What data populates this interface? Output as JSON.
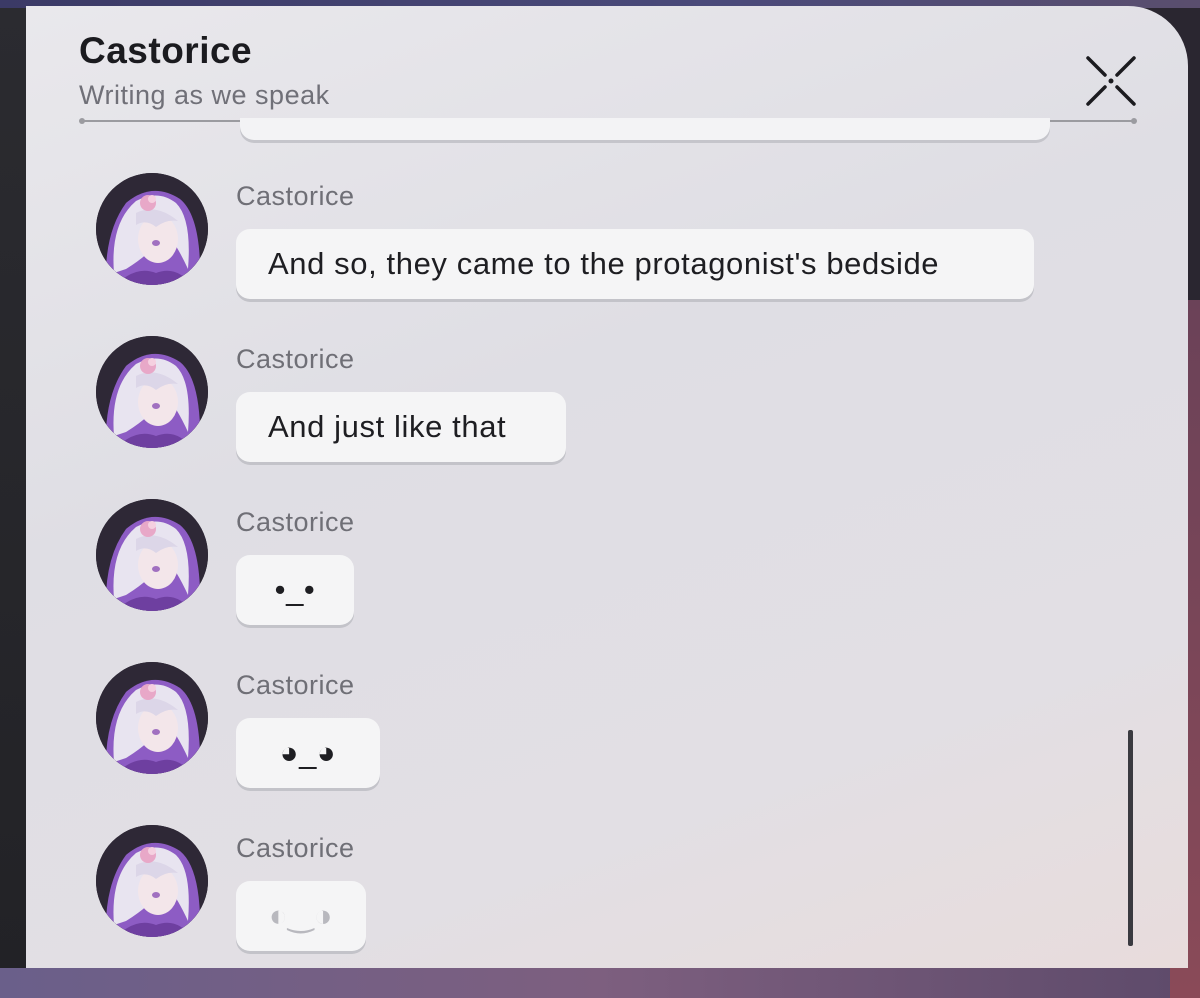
{
  "header": {
    "title": "Castorice",
    "subtitle": "Writing as we speak"
  },
  "messages": [
    {
      "sender": "Castorice",
      "text": "And so, they came to the protagonist's bedside"
    },
    {
      "sender": "Castorice",
      "text": "And just like that"
    },
    {
      "sender": "Castorice",
      "text": "•_•"
    },
    {
      "sender": "Castorice",
      "text": "◕_◕"
    },
    {
      "sender": "Castorice",
      "text": "◐‿◑"
    }
  ],
  "icons": {
    "close": "close-icon",
    "avatar": "avatar"
  },
  "colors": {
    "avatar_accent": "#9b6bc9",
    "hair": "#e7e3f0"
  }
}
